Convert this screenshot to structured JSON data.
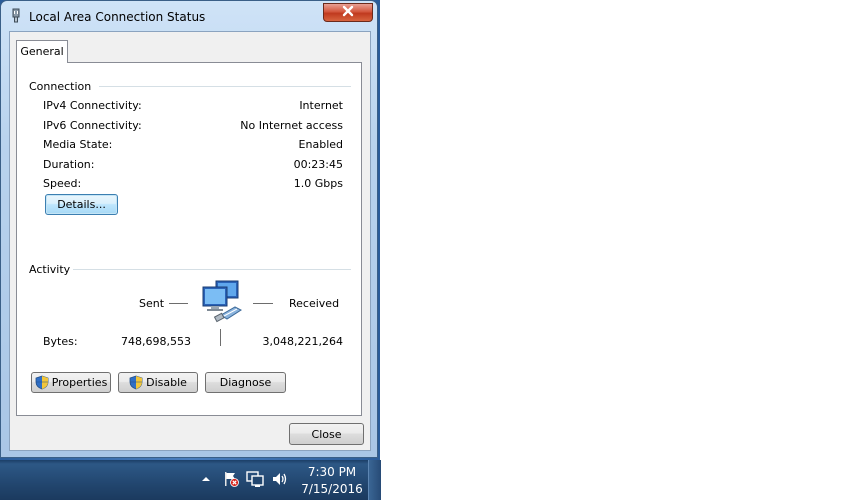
{
  "window": {
    "title": "Local Area Connection Status",
    "close_glyph": "✕"
  },
  "tabs": [
    {
      "label": "General"
    }
  ],
  "connection": {
    "heading": "Connection",
    "rows": [
      {
        "label": "IPv4 Connectivity:",
        "value": "Internet"
      },
      {
        "label": "IPv6 Connectivity:",
        "value": "No Internet access"
      },
      {
        "label": "Media State:",
        "value": "Enabled"
      },
      {
        "label": "Duration:",
        "value": "00:23:45"
      },
      {
        "label": "Speed:",
        "value": "1.0 Gbps"
      }
    ],
    "details_button": "Details..."
  },
  "activity": {
    "heading": "Activity",
    "sent_label": "Sent",
    "received_label": "Received",
    "bytes_label": "Bytes:",
    "bytes_sent": "748,698,553",
    "bytes_received": "3,048,221,264"
  },
  "buttons": {
    "properties": "Properties",
    "disable": "Disable",
    "diagnose": "Diagnose",
    "close": "Close"
  },
  "taskbar": {
    "time": "7:30 PM",
    "date": "7/15/2016",
    "tray_icons": [
      "show-hidden-icons-arrow",
      "action-center-flag-icon",
      "network-icon",
      "volume-icon"
    ]
  },
  "colors": {
    "focus_button_border": "#3c7fb1",
    "close_button_red": "#c03a1f",
    "taskbar_blue": "#22466f"
  }
}
